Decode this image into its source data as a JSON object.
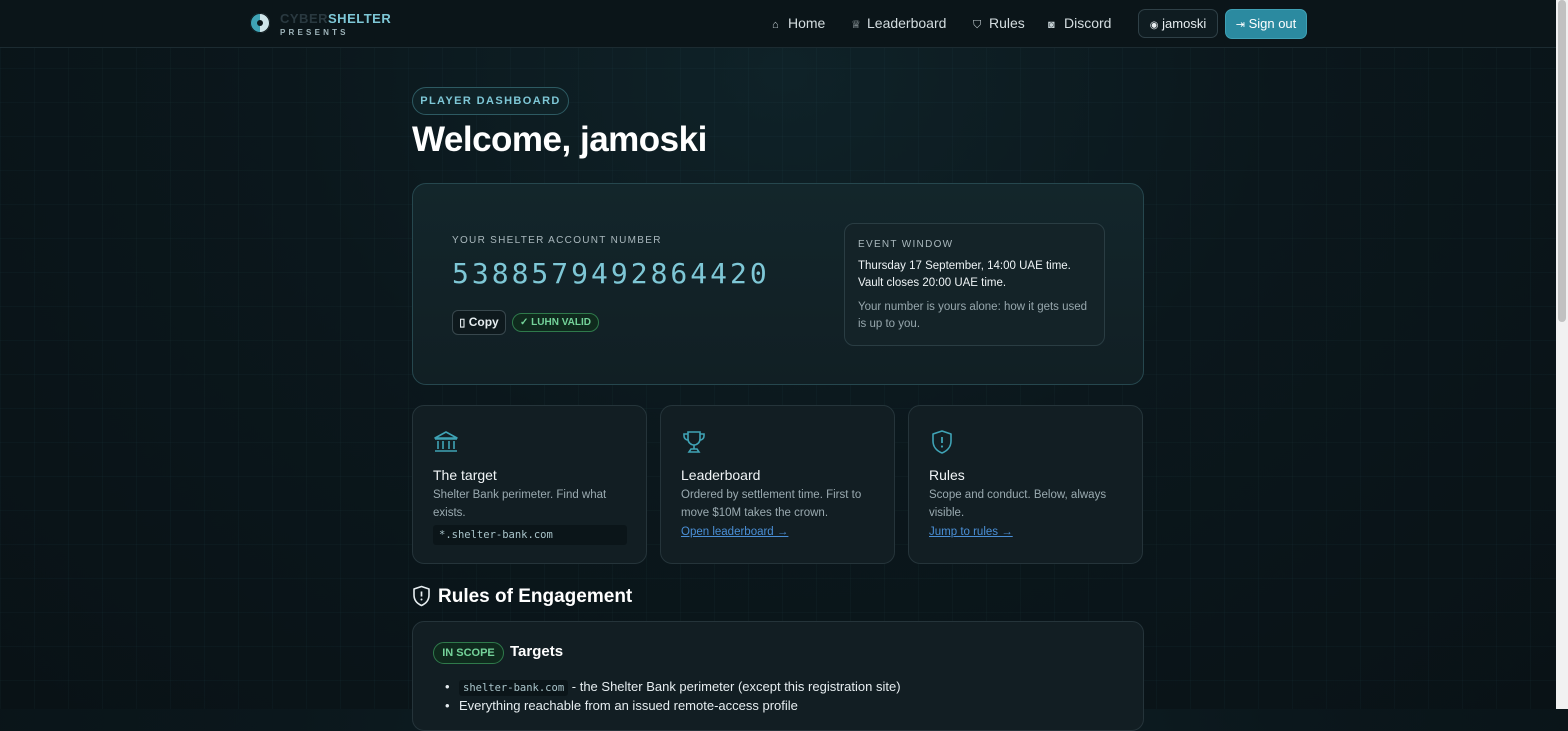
{
  "brand": {
    "word1": "CYBER",
    "word2": "SHELTER",
    "sub": "PRESENTS"
  },
  "nav": {
    "home": "Home",
    "leaderboard": "Leaderboard",
    "rules": "Rules",
    "discord": "Discord",
    "user": "jamoski",
    "signout": "Sign out"
  },
  "header": {
    "badge": "PLAYER DASHBOARD",
    "welcome": "Welcome, jamoski"
  },
  "account": {
    "label": "YOUR SHELTER ACCOUNT NUMBER",
    "number": "5388579492864420",
    "copy": "Copy",
    "status": "LUHN VALID"
  },
  "event": {
    "label": "EVENT WINDOW",
    "line1": "Thursday 17 September, 14:00 UAE time.",
    "line2": "Vault closes 20:00 UAE time.",
    "note": "Your number is yours alone: how it gets used is up to you."
  },
  "cards": [
    {
      "title": "The target",
      "desc": "Shelter Bank perimeter. Find what exists.",
      "code": "*.shelter-bank.com"
    },
    {
      "title": "Leaderboard",
      "desc": "Ordered by settlement time. First to move $10M takes the crown.",
      "link": "Open leaderboard →"
    },
    {
      "title": "Rules",
      "desc": "Scope and conduct. Below, always visible.",
      "link": "Jump to rules →"
    }
  ],
  "roe": {
    "title": "Rules of Engagement",
    "scope_badge": "IN SCOPE",
    "section": "Targets",
    "items": [
      {
        "code": "shelter-bank.com",
        "text": " - the Shelter Bank perimeter (except this registration site)"
      },
      {
        "text": "Everything reachable from an issued remote-access profile"
      }
    ]
  },
  "colors": {
    "accent": "#7ec7d6",
    "button": "#2b8aa0",
    "success": "#74d39a",
    "link": "#4a8fd6"
  }
}
